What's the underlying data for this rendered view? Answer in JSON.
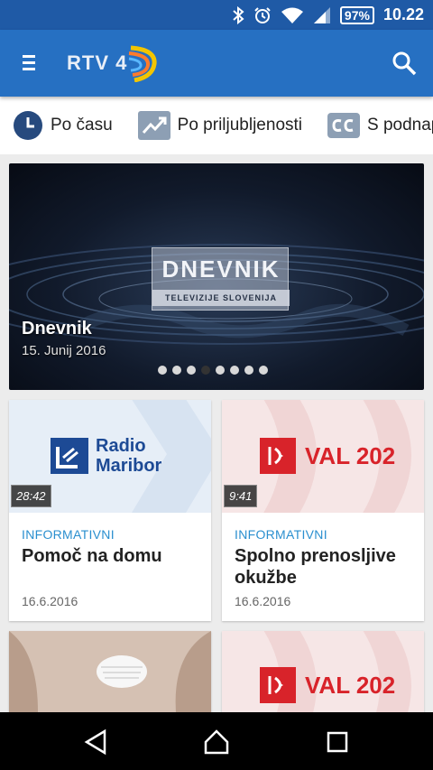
{
  "status_bar": {
    "battery": "97%",
    "time": "10.22",
    "icons": [
      "bluetooth-icon",
      "alarm-icon",
      "wifi-icon",
      "signal-icon",
      "battery-icon"
    ]
  },
  "app_bar": {
    "logo_text": "RTV 4",
    "icons": [
      "menu-icon",
      "search-icon"
    ]
  },
  "filters": [
    {
      "label": "Po času",
      "icon": "clock-icon"
    },
    {
      "label": "Po priljubljenosti",
      "icon": "trending-icon"
    },
    {
      "label": "S podnap",
      "icon": "cc-icon"
    }
  ],
  "hero": {
    "logo_title": "DNEVNIK",
    "logo_subtitle": "TELEVIZIJE SLOVENIJA",
    "title": "Dnevnik",
    "date": "15. Junij 2016",
    "slide_count": 8,
    "active_slide": 4
  },
  "cards": [
    {
      "brand": "Radio Maribor",
      "brand_line1": "Radio",
      "brand_line2": "Maribor",
      "duration": "28:42",
      "category": "INFORMATIVNI",
      "title": "Pomoč na domu",
      "date": "16.6.2016"
    },
    {
      "brand": "VAL 202",
      "duration": "9:41",
      "category": "INFORMATIVNI",
      "title": "Spolno prenosljive okužbe",
      "date": "16.6.2016"
    },
    {
      "brand": "",
      "duration": "",
      "category": "",
      "title": "",
      "date": ""
    },
    {
      "brand": "VAL 202",
      "duration": "",
      "category": "",
      "title": "",
      "date": ""
    }
  ],
  "colors": {
    "status_bar": "#1f5aa6",
    "app_bar": "#2670c2",
    "category": "#2a8fcf",
    "val_red": "#d8232a",
    "radio_blue": "#1d4a95"
  },
  "nav_bar": {
    "icons": [
      "back-icon",
      "home-icon",
      "recents-icon"
    ]
  }
}
